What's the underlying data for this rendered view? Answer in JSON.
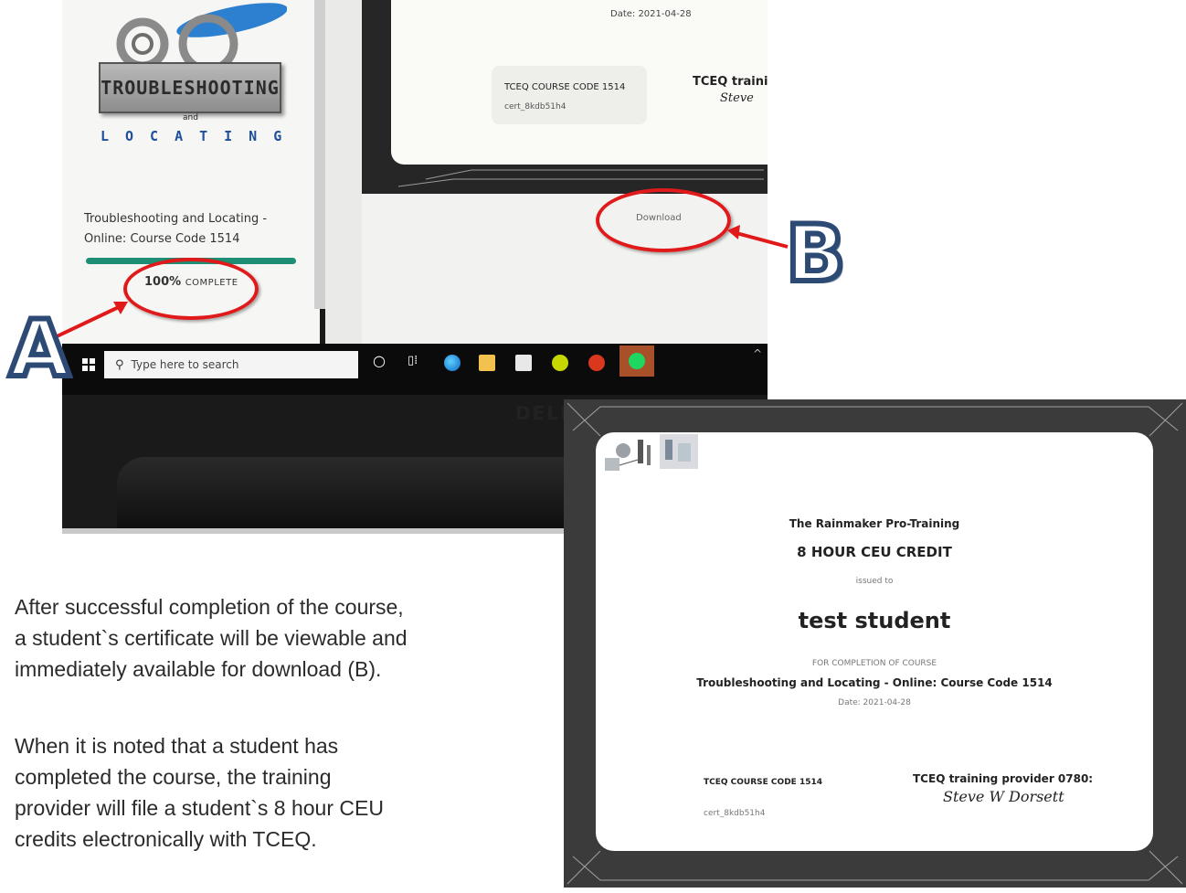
{
  "screenshot": {
    "logo": {
      "word_top": "TROUBLESHOOTING",
      "word_and": "and",
      "word_bottom": "LOCATING"
    },
    "course_title": "Troubleshooting and Locating - Online: Course Code 1514",
    "progress": {
      "percent": 100,
      "percent_label": "100%",
      "status_label": "COMPLETE"
    },
    "small_certificate": {
      "date": "Date: 2021-04-28",
      "course_code": "TCEQ COURSE CODE 1514",
      "cert_id": "cert_8kdb51h4",
      "provider_partial": "TCEQ traini",
      "signature_partial": "Steve"
    },
    "download_label": "Download",
    "taskbar": {
      "search_placeholder": "Type here to search",
      "icons": [
        "windows-start-icon",
        "search-icon",
        "cortana-icon",
        "task-view-icon",
        "edge-icon",
        "file-explorer-icon",
        "store-icon",
        "app-icon",
        "app-red-icon",
        "spotify-icon"
      ]
    },
    "bezel_text": "DELL",
    "annotations": {
      "a": "A",
      "b": "B",
      "color": "#e01a1a"
    }
  },
  "certificate": {
    "organization": "The Rainmaker Pro-Training",
    "title": "8 HOUR CEU CREDIT",
    "issued_to_label": "issued to",
    "student_name": "test student",
    "for_completion_label": "FOR COMPLETION OF COURSE",
    "course_name": "Troubleshooting and Locating - Online: Course Code 1514",
    "date": "Date: 2021-04-28",
    "course_code": "TCEQ COURSE CODE 1514",
    "cert_id": "cert_8kdb51h4",
    "provider": "TCEQ training provider 0780:",
    "signature": "Steve W Dorsett"
  },
  "paragraph_1": {
    "line1": "After successful completion of the course,",
    "line2": "a student`s certificate will be viewable and",
    "line3": "immediately available for download (B)."
  },
  "paragraph_2": {
    "line1": "When it is noted that a student has",
    "line2": "completed the course, the training",
    "line3": "provider will file a student`s 8 hour CEU",
    "line4": "credits electronically with TCEQ."
  }
}
